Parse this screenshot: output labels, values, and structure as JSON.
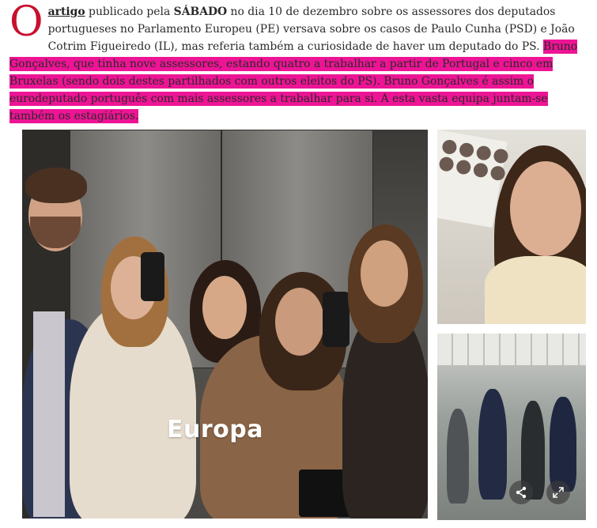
{
  "article": {
    "dropcap": "O",
    "link_text": "artigo",
    "text_1": " publicado pela ",
    "brand": "SÁBADO",
    "text_2": " no dia 10 de dezembro sobre os assessores dos deputados portugueses no Parlamento Europeu (PE) versava sobre os casos de Paulo Cunha (PSD) e João Cotrim Figueiredo (IL), mas referia também a curiosidade de haver um deputado do PS. ",
    "highlight": "Bruno Gonçalves, que tinha nove assessores, estando quatro a trabalhar a partir de Portugal e cinco em Bruxelas (sendo dois destes partilhados com outros eleitos do PS). Bruno Gonçalves é assim o eurodeputado português com mais assessores a trabalhar para si. A esta vasta equipa juntam-se também os estagiários."
  },
  "gallery": {
    "main_caption": "Europa",
    "share_icon": "share-icon",
    "expand_icon": "expand-icon"
  },
  "colors": {
    "dropcap": "#c8102e",
    "highlight": "#ec008c"
  }
}
